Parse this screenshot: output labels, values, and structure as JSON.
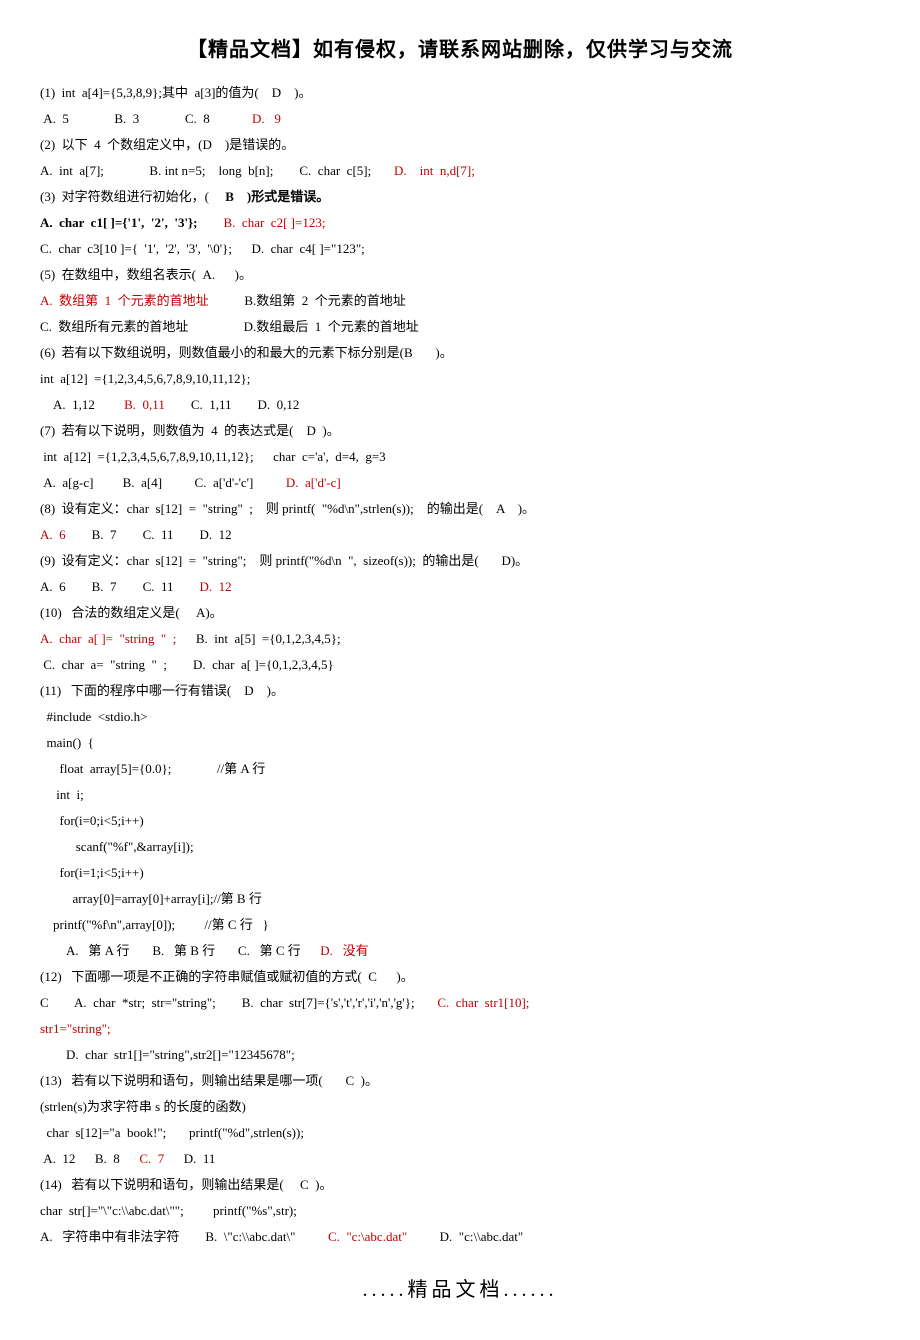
{
  "header": "【精品文档】如有侵权，请联系网站删除，仅供学习与交流",
  "footer": ".....精品文档......",
  "q1": {
    "stem": "(1)  int  a[4]={5,3,8,9};其中  a[3]的值为(    D    )。",
    "a": " A.  5",
    "b": "B.  3",
    "c": "C.  8",
    "d": "D.   9"
  },
  "q2": {
    "stem": "(2)  以下  4  个数组定义中，(D    )是错误的。",
    "a": "A.  int  a[7];",
    "b": "B. int n=5;    long  b[n];",
    "c": "C.  char  c[5];",
    "d": "D.    int  n,d[7];"
  },
  "q3": {
    "stem_a": "(3)  对字符数组进行初始化，(",
    "stem_b": "B",
    "stem_c": ")形式是错误。",
    "a": "A.  char  c1[ ]={'1',  '2',  '3'};",
    "b": "B.  char  c2[ ]=123;",
    "c": "C.  char  c3[10 ]={  '1',  '2',  '3',  '\\0'};",
    "d": "D.  char  c4[ ]=\"123\";"
  },
  "q5": {
    "stem": "(5)  在数组中，数组名表示(  A.      )。",
    "a": "A.  数组第  1  个元素的首地址",
    "b": "B.数组第  2  个元素的首地址",
    "c": "C.  数组所有元素的首地址",
    "d": "D.数组最后  1  个元素的首地址"
  },
  "q6": {
    "stem": "(6)  若有以下数组说明，则数值最小的和最大的元素下标分别是(B       )。",
    "decl": "int  a[12]  ={1,2,3,4,5,6,7,8,9,10,11,12};",
    "a": "A.  1,12",
    "b": "B.  0,11",
    "c": "C.  1,11",
    "d": "D.  0,12"
  },
  "q7": {
    "stem": "(7)  若有以下说明，则数值为  4  的表达式是(    D  )。",
    "decl": " int  a[12]  ={1,2,3,4,5,6,7,8,9,10,11,12};      char  c='a',  d=4,  g=3",
    "a": " A.  a[g-c]",
    "b": "B.  a[4]",
    "c": "C.  a['d'-'c']",
    "d": "D.  a['d'-c]"
  },
  "q8": {
    "stem": "(8)  设有定义：char  s[12]  =  \"string\"  ;    则 printf(  \"%d\\n\",strlen(s));    的输出是(    A    )。",
    "a": "A.  6",
    "b": "B.  7",
    "c": "C.  11",
    "d": "D.  12"
  },
  "q9": {
    "stem": "(9)  设有定义：char  s[12]  =  \"string\";    则 printf(\"%d\\n  \",  sizeof(s));  的输出是(       D)。",
    "a": "A.  6",
    "b": "B.  7",
    "c": "C.  11",
    "d": "D.  12"
  },
  "q10": {
    "stem": "(10)   合法的数组定义是(     A)。",
    "a": "A.  char  a[ ]=  \"string  \"  ;",
    "b": "B.  int  a[5]  ={0,1,2,3,4,5};",
    "c": " C.  char  a=  \"string  \"  ;",
    "d": "D.  char  a[ ]={0,1,2,3,4,5}"
  },
  "q11": {
    "stem": "(11)   下面的程序中哪一行有错误(    D    )。",
    "code": [
      "  #include  <stdio.h>",
      "  main()  {",
      "      float  array[5]={0.0};              //第 A 行",
      "     int  i;",
      "      for(i=0;i<5;i++)",
      "           scanf(\"%f\",&array[i]);",
      "      for(i=1;i<5;i++)",
      "          array[0]=array[0]+array[i];//第 B 行",
      "    printf(\"%f\\n\",array[0]);         //第 C 行   }"
    ],
    "a": "A.   第 A 行",
    "b": "B.   第 B 行",
    "c": "C.   第 C 行",
    "d": "D.   没有"
  },
  "q12": {
    "stem": "(12)   下面哪一项是不正确的字符串赋值或赋初值的方式(  C      )。",
    "line2_c": "C",
    "a": "A.  char  *str;  str=\"string\";",
    "b": "B.  char  str[7]={'s','t','r','i','n','g'};",
    "c_a": "C.  char  str1[10];",
    "c_b": "str1=\"string\";",
    "d": "        D.  char  str1[]=\"string\",str2[]=\"12345678\";"
  },
  "q13": {
    "stem": "(13)   若有以下说明和语句，则输出结果是哪一项(       C  )。",
    "note": "(strlen(s)为求字符串 s 的长度的函数)",
    "decl": "  char  s[12]=\"a  book!\";       printf(\"%d\",strlen(s));",
    "a": " A.  12",
    "b": "B.  8",
    "c": "C.  7",
    "d": "D.  11"
  },
  "q14": {
    "stem": "(14)   若有以下说明和语句，则输出结果是(     C  )。",
    "decl": "char  str[]=\"\\\"c:\\\\abc.dat\\\"\";         printf(\"%s\",str);",
    "a": "A.   字符串中有非法字符",
    "b": "B.  \\\"c:\\\\abc.dat\\\"",
    "c": "C.  \"c:\\abc.dat\"",
    "d": "D.  \"c:\\\\abc.dat\""
  }
}
